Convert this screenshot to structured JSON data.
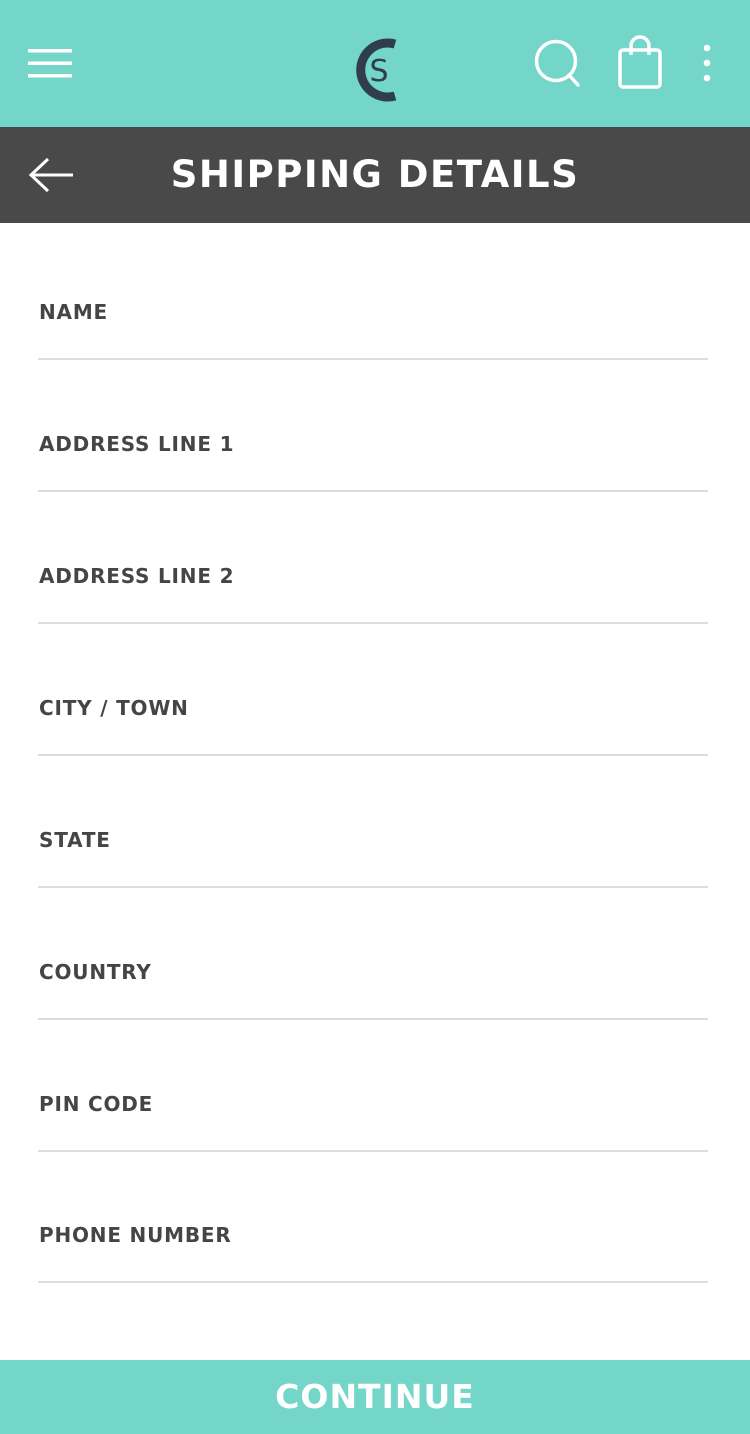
{
  "colors": {
    "accent": "#74d5c9",
    "title_bar": "#494949",
    "label_text": "#454545",
    "field_divider": "#dedede",
    "logo": "#2f3e4a"
  },
  "header": {
    "icons": [
      "menu-icon",
      "logo-icon",
      "search-icon",
      "shopping-bag-icon",
      "more-vertical-icon"
    ],
    "logo_letter": "S"
  },
  "title_bar": {
    "back_icon": "arrow-left-icon",
    "title": "SHIPPING DETAILS"
  },
  "form": {
    "fields": [
      {
        "label": "NAME",
        "value": ""
      },
      {
        "label": "ADDRESS LINE 1",
        "value": ""
      },
      {
        "label": "ADDRESS LINE 2",
        "value": ""
      },
      {
        "label": "CITY / TOWN",
        "value": ""
      },
      {
        "label": "STATE",
        "value": ""
      },
      {
        "label": "COUNTRY",
        "value": ""
      },
      {
        "label": "PIN CODE",
        "value": ""
      },
      {
        "label": "PHONE NUMBER",
        "value": ""
      }
    ]
  },
  "footer": {
    "continue_label": "CONTINUE"
  }
}
